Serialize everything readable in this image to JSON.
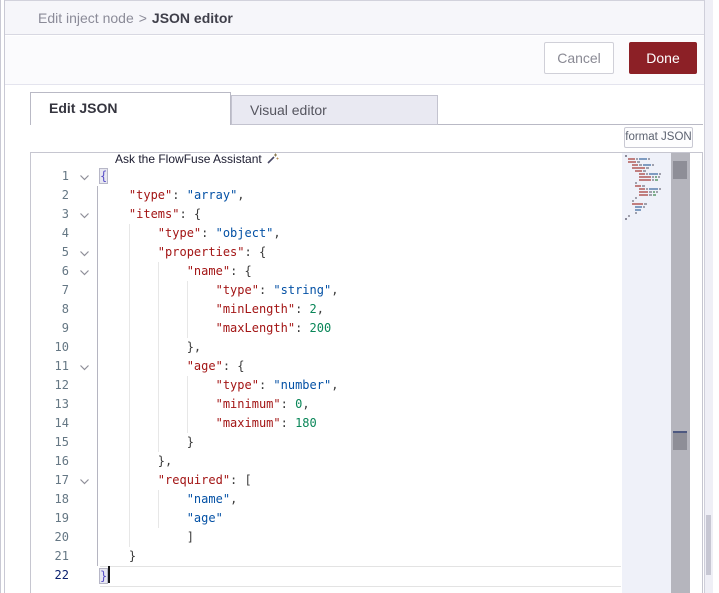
{
  "window": {
    "breadcrumb_parent": "Edit inject node",
    "breadcrumb_separator": ">",
    "breadcrumb_current": "JSON editor"
  },
  "buttons": {
    "cancel": "Cancel",
    "done": "Done",
    "format_json": "format JSON"
  },
  "tabs": {
    "edit_json": "Edit JSON",
    "visual_editor": "Visual editor"
  },
  "assistant": {
    "label": "Ask the FlowFuse Assistant",
    "icon": "magic-wand-icon"
  },
  "colors": {
    "done_button": "#8C2026",
    "json_key": "#a31515",
    "json_string_value": "#0451a5",
    "json_number": "#098658",
    "matched_bracket": "#5a50c8",
    "tab_inactive_bg": "#e9e9f2",
    "header_bg": "#f6f6fa"
  },
  "editor": {
    "language": "json",
    "cursor": {
      "line": 22,
      "column": 2
    },
    "lines": [
      {
        "n": 1,
        "fold": true,
        "cur": false,
        "tokens": [
          [
            "b",
            "{"
          ]
        ]
      },
      {
        "n": 2,
        "fold": false,
        "cur": false,
        "tokens": [
          [
            "w",
            "    "
          ],
          [
            "k",
            "\"type\""
          ],
          [
            "p",
            ": "
          ],
          [
            "v",
            "\"array\""
          ],
          [
            "p",
            ","
          ]
        ]
      },
      {
        "n": 3,
        "fold": true,
        "cur": false,
        "tokens": [
          [
            "w",
            "    "
          ],
          [
            "k",
            "\"items\""
          ],
          [
            "p",
            ": {"
          ]
        ]
      },
      {
        "n": 4,
        "fold": false,
        "cur": false,
        "tokens": [
          [
            "w",
            "        "
          ],
          [
            "k",
            "\"type\""
          ],
          [
            "p",
            ": "
          ],
          [
            "v",
            "\"object\""
          ],
          [
            "p",
            ","
          ]
        ]
      },
      {
        "n": 5,
        "fold": true,
        "cur": false,
        "tokens": [
          [
            "w",
            "        "
          ],
          [
            "k",
            "\"properties\""
          ],
          [
            "p",
            ": {"
          ]
        ]
      },
      {
        "n": 6,
        "fold": true,
        "cur": false,
        "tokens": [
          [
            "w",
            "            "
          ],
          [
            "k",
            "\"name\""
          ],
          [
            "p",
            ": {"
          ]
        ]
      },
      {
        "n": 7,
        "fold": false,
        "cur": false,
        "tokens": [
          [
            "w",
            "                "
          ],
          [
            "k",
            "\"type\""
          ],
          [
            "p",
            ": "
          ],
          [
            "v",
            "\"string\""
          ],
          [
            "p",
            ","
          ]
        ]
      },
      {
        "n": 8,
        "fold": false,
        "cur": false,
        "tokens": [
          [
            "w",
            "                "
          ],
          [
            "k",
            "\"minLength\""
          ],
          [
            "p",
            ": "
          ],
          [
            "n",
            "2"
          ],
          [
            "p",
            ","
          ]
        ]
      },
      {
        "n": 9,
        "fold": false,
        "cur": false,
        "tokens": [
          [
            "w",
            "                "
          ],
          [
            "k",
            "\"maxLength\""
          ],
          [
            "p",
            ": "
          ],
          [
            "n",
            "200"
          ]
        ]
      },
      {
        "n": 10,
        "fold": false,
        "cur": false,
        "tokens": [
          [
            "w",
            "            "
          ],
          [
            "p",
            "},"
          ]
        ]
      },
      {
        "n": 11,
        "fold": true,
        "cur": false,
        "tokens": [
          [
            "w",
            "            "
          ],
          [
            "k",
            "\"age\""
          ],
          [
            "p",
            ": {"
          ]
        ]
      },
      {
        "n": 12,
        "fold": false,
        "cur": false,
        "tokens": [
          [
            "w",
            "                "
          ],
          [
            "k",
            "\"type\""
          ],
          [
            "p",
            ": "
          ],
          [
            "v",
            "\"number\""
          ],
          [
            "p",
            ","
          ]
        ]
      },
      {
        "n": 13,
        "fold": false,
        "cur": false,
        "tokens": [
          [
            "w",
            "                "
          ],
          [
            "k",
            "\"minimum\""
          ],
          [
            "p",
            ": "
          ],
          [
            "n",
            "0"
          ],
          [
            "p",
            ","
          ]
        ]
      },
      {
        "n": 14,
        "fold": false,
        "cur": false,
        "tokens": [
          [
            "w",
            "                "
          ],
          [
            "k",
            "\"maximum\""
          ],
          [
            "p",
            ": "
          ],
          [
            "n",
            "180"
          ]
        ]
      },
      {
        "n": 15,
        "fold": false,
        "cur": false,
        "tokens": [
          [
            "w",
            "            "
          ],
          [
            "p",
            "}"
          ]
        ]
      },
      {
        "n": 16,
        "fold": false,
        "cur": false,
        "tokens": [
          [
            "w",
            "        "
          ],
          [
            "p",
            "},"
          ]
        ]
      },
      {
        "n": 17,
        "fold": true,
        "cur": false,
        "tokens": [
          [
            "w",
            "        "
          ],
          [
            "k",
            "\"required\""
          ],
          [
            "p",
            ": ["
          ]
        ]
      },
      {
        "n": 18,
        "fold": false,
        "cur": false,
        "tokens": [
          [
            "w",
            "            "
          ],
          [
            "v",
            "\"name\""
          ],
          [
            "p",
            ","
          ]
        ]
      },
      {
        "n": 19,
        "fold": false,
        "cur": false,
        "tokens": [
          [
            "w",
            "            "
          ],
          [
            "v",
            "\"age\""
          ]
        ]
      },
      {
        "n": 20,
        "fold": false,
        "cur": false,
        "tokens": [
          [
            "w",
            "            "
          ],
          [
            "p",
            "]"
          ]
        ]
      },
      {
        "n": 21,
        "fold": false,
        "cur": false,
        "tokens": [
          [
            "w",
            "    "
          ],
          [
            "p",
            "}"
          ]
        ]
      },
      {
        "n": 22,
        "fold": false,
        "cur": true,
        "tokens": [
          [
            "b",
            "}"
          ],
          [
            "cursor",
            ""
          ]
        ]
      }
    ]
  }
}
